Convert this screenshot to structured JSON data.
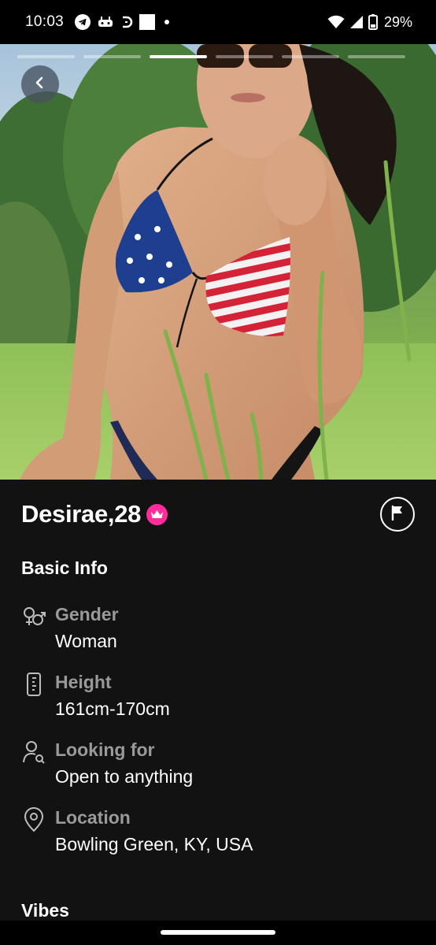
{
  "status_bar": {
    "time": "10:03",
    "battery": "29%",
    "left_icons": [
      "telegram-icon",
      "game-controller-icon",
      "d-app-icon",
      "square-app-icon",
      "dot-icon"
    ],
    "right_icons": [
      "wifi-icon",
      "cell-signal-icon",
      "battery-icon"
    ]
  },
  "photo": {
    "total_photos": 7,
    "current_photo": 3,
    "description_icon": "profile-photo"
  },
  "profile": {
    "name_age": "Desirae,28",
    "badge_icon": "crown-icon",
    "badge_color": "#ff2d9b",
    "report_icon": "flag-icon"
  },
  "basic_info": {
    "title": "Basic Info",
    "items": [
      {
        "icon": "gender-icon",
        "label": "Gender",
        "value": "Woman"
      },
      {
        "icon": "height-ruler-icon",
        "label": "Height",
        "value": "161cm-170cm"
      },
      {
        "icon": "person-search-icon",
        "label": "Looking for",
        "value": "Open to anything"
      },
      {
        "icon": "location-pin-icon",
        "label": "Location",
        "value": "Bowling Green, KY, USA"
      }
    ]
  },
  "vibes": {
    "title": "Vibes"
  }
}
